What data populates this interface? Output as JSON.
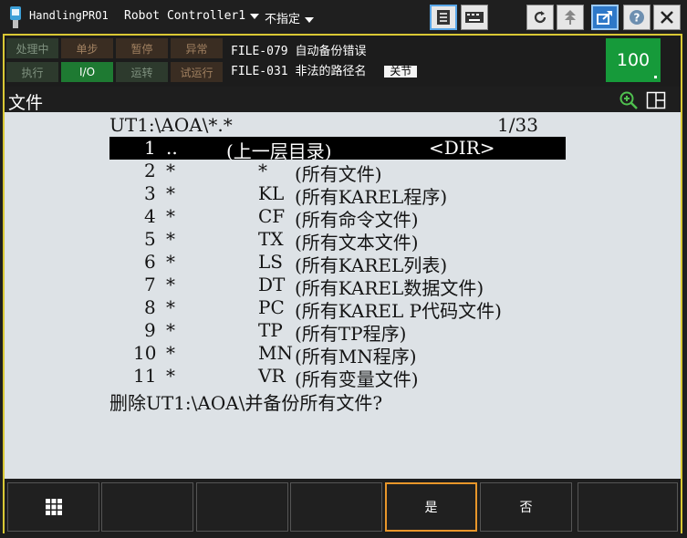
{
  "titlebar": {
    "program_name": "HandlingPRO1",
    "controller_label": "Robot Controller1",
    "group_label": "不指定"
  },
  "status": {
    "lamps_row1": [
      "处理中",
      "单步",
      "暂停",
      "异常"
    ],
    "lamps_row2": [
      "执行",
      "I/O",
      "运转",
      "试运行"
    ],
    "messages": [
      {
        "code": "FILE-079",
        "text": "自动备份错误",
        "button": ""
      },
      {
        "code": "FILE-031",
        "text": "非法的路径名",
        "button": "关节"
      }
    ],
    "override": "100"
  },
  "screen": {
    "title": "文件",
    "path": "UT1:\\AOA\\*.*",
    "page": "1/33",
    "rows": [
      {
        "num": "1",
        "pattern": "..",
        "type": "",
        "desc": "(上一层目录)",
        "extra": "<DIR>"
      },
      {
        "num": "2",
        "pattern": "*",
        "type": "*",
        "desc": "(所有文件)",
        "extra": ""
      },
      {
        "num": "3",
        "pattern": "*",
        "type": "KL",
        "desc": "(所有KAREL程序)",
        "extra": ""
      },
      {
        "num": "4",
        "pattern": "*",
        "type": "CF",
        "desc": "(所有命令文件)",
        "extra": ""
      },
      {
        "num": "5",
        "pattern": "*",
        "type": "TX",
        "desc": "(所有文本文件)",
        "extra": ""
      },
      {
        "num": "6",
        "pattern": "*",
        "type": "LS",
        "desc": "(所有KAREL列表)",
        "extra": ""
      },
      {
        "num": "7",
        "pattern": "*",
        "type": "DT",
        "desc": "(所有KAREL数据文件)",
        "extra": ""
      },
      {
        "num": "8",
        "pattern": "*",
        "type": "PC",
        "desc": "(所有KAREL P代码文件)",
        "extra": ""
      },
      {
        "num": "9",
        "pattern": "*",
        "type": "TP",
        "desc": "(所有TP程序)",
        "extra": ""
      },
      {
        "num": "10",
        "pattern": "*",
        "type": "MN",
        "desc": "(所有MN程序)",
        "extra": ""
      },
      {
        "num": "11",
        "pattern": "*",
        "type": "VR",
        "desc": "(所有变量文件)",
        "extra": ""
      }
    ],
    "confirm": "删除UT1:\\AOA\\并备份所有文件?"
  },
  "fkeys": {
    "yes": "是",
    "no": "否"
  },
  "colors": {
    "frame_accent": "#d9c834",
    "screen_bg": "#dde2e6",
    "override_green": "#169a3a",
    "focus_orange": "#e8962a"
  }
}
